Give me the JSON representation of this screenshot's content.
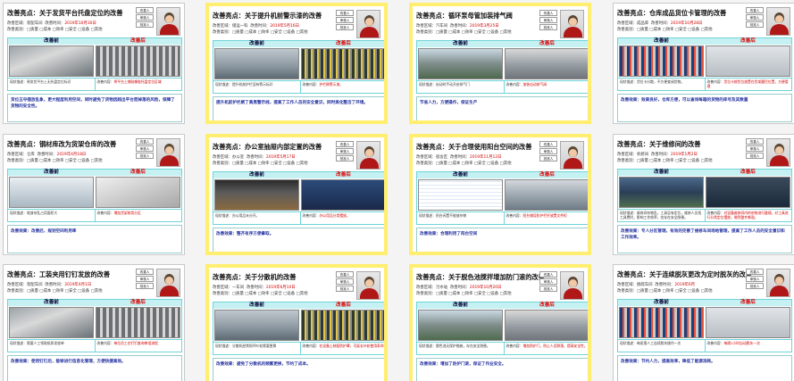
{
  "common": {
    "label": "改善亮点：",
    "before": "改善前",
    "after": "改善后",
    "roles": [
      "改善人",
      "审核人",
      "批准人"
    ],
    "area_label": "改善区域：",
    "time_label": "改善时间：",
    "type_label": "改善类别：",
    "types": "□质量 □成本 □效率 □安全 □设备 □其他",
    "before_desc_label": "现状描述：",
    "after_desc_label": "改善内容：",
    "effect_label": "改善效果："
  },
  "cards": [
    {
      "subject": "关于发货平台托盘定位的改善",
      "area": "装配车间",
      "time": "2019年10月30日",
      "before_desc": "原发货平台上无托盘定位标识",
      "after_desc": "将平台上铺贴橡胶托盘定位区域",
      "effect": "货位五夺摆放乱象，更大程度利用空间，同时避免了货物因超出平台而掉落的风险，保障了货物的安全性。"
    },
    {
      "subject": "关于提升机前警示漆的改善",
      "area": "储运一科",
      "time": "2019年5月16日",
      "before_desc": "提升机前护栏没有警示标识",
      "after_desc": "护栏刷警示漆。",
      "effect": "提升机前护栏刷了黄黑警示线，提高了工作人员的安全意识，同时美化整洁了环境。"
    },
    {
      "subject": "循环泵母管加装排气阀",
      "area": "汽车间",
      "time": "2019年3月25日",
      "before_desc": "启动时手动开启排气门",
      "after_desc": "加装自动排气阀",
      "effect": "节省人力，方便操作，保证生产"
    },
    {
      "subject": "仓库成品货位卡管理的改善",
      "area": "成品库",
      "time": "2019年10月28日",
      "before_desc": "货位卡分散，不方便查阅货物。",
      "after_desc": "货位卡按货位放置在货架醒目位置，方便管理",
      "effect": "改善效果：效果良好，仓库方便，可以查询每箱的货物的库号及其数量"
    },
    {
      "subject": "钢材库改为货架仓库的改善",
      "area": "仓库",
      "time": "2019年4月18日",
      "before_desc": "堆放杂乱占用面积大",
      "after_desc": "增加货架按类分区",
      "effect": "改善效果：改善后，规划空间利用率"
    },
    {
      "subject": "办公室抽屉内部定置的改善",
      "area": "办公室",
      "time": "2019年5月17日",
      "before_desc": "办公用品未分开。",
      "after_desc": "办公用品分类摆放。",
      "effect": "改善效果：整齐有序方便拿取。"
    },
    {
      "subject": "关于合理使用阳台空间的改善",
      "area": "宿舍区",
      "time": "2019年11月12日",
      "before_desc": "阳台闲置不能放杂物",
      "after_desc": "阳台铺设防护栏杆放置文件柜",
      "effect": "改善效果：合理利用了阳台空间"
    },
    {
      "subject": "关于维修间的改善",
      "area": "机修间",
      "time": "2019年1月2日",
      "before_desc": "维修间杂物乱，工具没有定位，维修人员找工具费时，影响工作效率，也存在安全隐患。",
      "after_desc": "对设备维修间内的杂物进行整理，对工具进行分类定位摆放，做到整齐美观。",
      "effect": "改善效果：专人分区管理，有效的完善了维修车间场地管理，提高了工作人员的安全意识和工作效率。"
    },
    {
      "subject": "工装夹用钉钉发放的改善",
      "area": "装配车间",
      "time": "2019年4月1日",
      "before_desc": "需要人工领取纸质发放单",
      "after_desc": "每位员工在钉钉查询审批流程",
      "effect": "改善效果：使用钉钉后，能够进行信息化管理，方便快捷高效。"
    },
    {
      "subject": "关于分散机的改善",
      "area": "一车间",
      "time": "2019年6月10日",
      "before_desc": "分散机经常损坏叶轮需要更换",
      "after_desc": "在设备上装配防护罩，可延长叶轮使用寿命",
      "effect": "改善效果：避免了分散机的频繁更换，节约了成本。"
    },
    {
      "subject": "关于脱色池搅拌增加防门滚的改善",
      "area": "污水站",
      "time": "2019年10月20日",
      "before_desc": "脱色池无保护措施，存在安全隐患。",
      "after_desc": "增加防护门，防止人员跌落，提高安全性。",
      "effect": "改善效果：增加了防护门滚，保证了作业安全。"
    },
    {
      "subject": "关于连续脱灰更改为定时脱灰的改善",
      "area": "脱硫车间",
      "time": "2019年6月",
      "before_desc": "每班需人工连续脱灰操作一次",
      "after_desc": "每隔1小时自动脱灰一次",
      "effect": "改善效果：节约人力，提高效率，降低了能源消耗。"
    }
  ]
}
